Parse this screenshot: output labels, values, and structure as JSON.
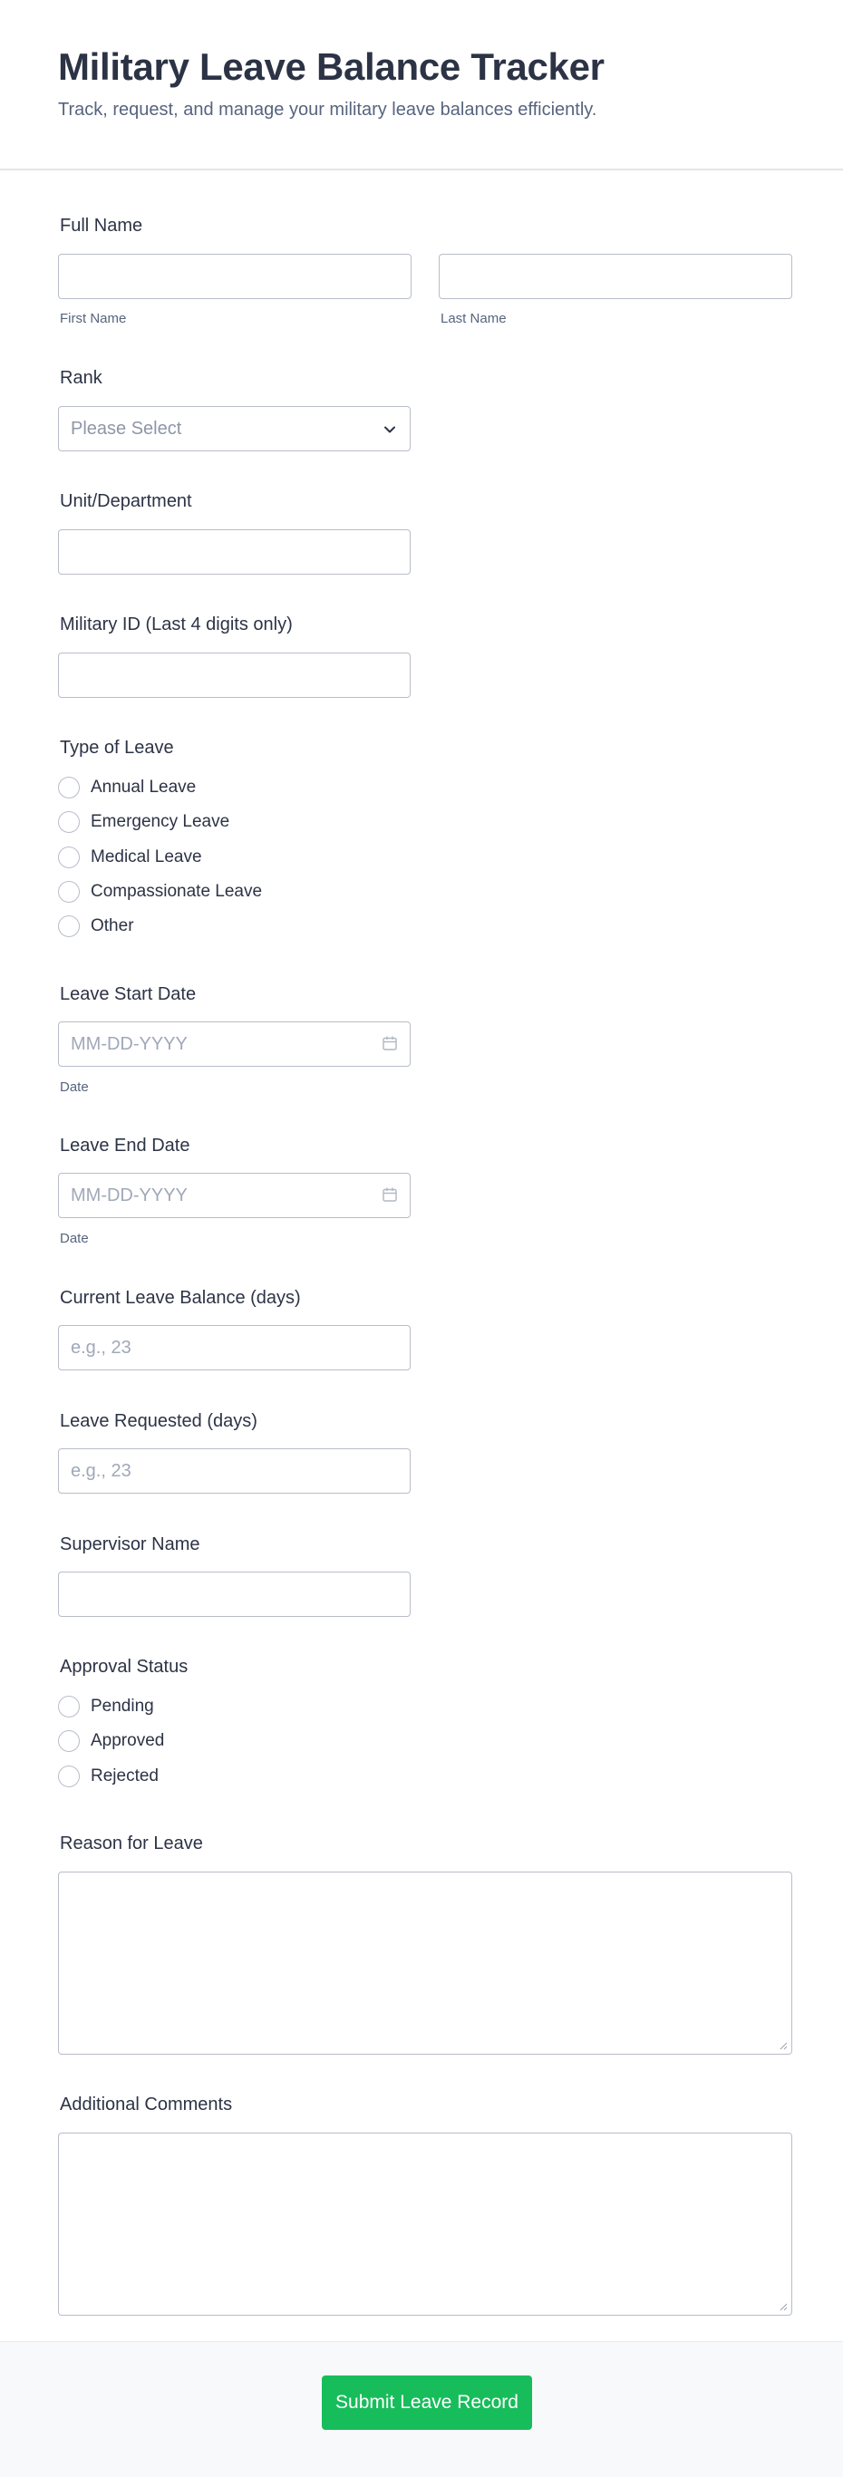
{
  "form": {
    "title": "Military Leave Balance Tracker",
    "subtitle": "Track, request, and manage your military leave balances efficiently."
  },
  "fields": {
    "full_name": {
      "label": "Full Name",
      "first_sublabel": "First Name",
      "last_sublabel": "Last Name",
      "first_value": "",
      "last_value": ""
    },
    "rank": {
      "label": "Rank",
      "selected": "Please Select"
    },
    "unit": {
      "label": "Unit/Department",
      "value": ""
    },
    "military_id": {
      "label": "Military ID (Last 4 digits only)",
      "value": ""
    },
    "leave_type": {
      "label": "Type of Leave",
      "options": [
        "Annual Leave",
        "Emergency Leave",
        "Medical Leave",
        "Compassionate Leave",
        "Other"
      ]
    },
    "start_date": {
      "label": "Leave Start Date",
      "placeholder": "MM-DD-YYYY",
      "sublabel": "Date"
    },
    "end_date": {
      "label": "Leave End Date",
      "placeholder": "MM-DD-YYYY",
      "sublabel": "Date"
    },
    "current_balance": {
      "label": "Current Leave Balance (days)",
      "placeholder": "e.g., 23"
    },
    "requested": {
      "label": "Leave Requested (days)",
      "placeholder": "e.g., 23"
    },
    "supervisor": {
      "label": "Supervisor Name",
      "value": ""
    },
    "approval_status": {
      "label": "Approval Status",
      "options": [
        "Pending",
        "Approved",
        "Rejected"
      ]
    },
    "reason": {
      "label": "Reason for Leave",
      "value": ""
    },
    "comments": {
      "label": "Additional Comments",
      "value": ""
    }
  },
  "submit": {
    "label": "Submit Leave Record"
  },
  "icons": {
    "select": "chevron-down-icon",
    "date": "calendar-icon",
    "textarea": "resize-grip-icon"
  },
  "colors": {
    "accent": "#18bd5b",
    "text": "#2c3345",
    "muted": "#57647e",
    "border": "#b8bdc9"
  }
}
